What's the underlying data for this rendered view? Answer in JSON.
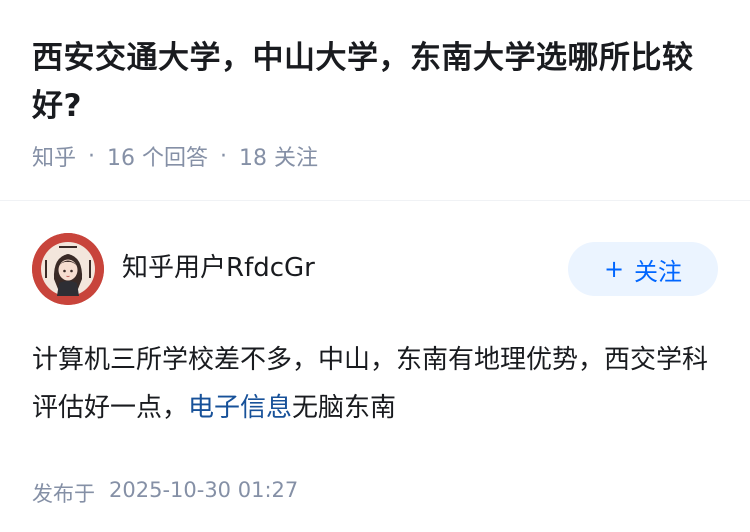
{
  "question": {
    "title": "西安交通大学，中山大学，东南大学选哪所比较好?",
    "source": "知乎",
    "answer_count": "16 个回答",
    "follower_count": "18 关注",
    "separator": "·"
  },
  "answer": {
    "author": {
      "name": "知乎用户RfdcGr",
      "avatar_icon": "girl-avatar-icon"
    },
    "follow_button": {
      "icon": "plus-icon",
      "plus": "+",
      "label": "关注"
    },
    "content": {
      "text_before_link": "计算机三所学校差不多，中山，东南有地理优势，西交学科评估好一点，",
      "link_text": "电子信息",
      "text_after_link": "无脑东南"
    },
    "publish": {
      "label": "发布于",
      "date": "2025-10-30 01:27"
    }
  },
  "colors": {
    "accent": "#0066ff",
    "link": "#175199",
    "muted": "#8590a6",
    "follow_bg": "#ebf4ff",
    "avatar_bg": "#c8443b"
  }
}
